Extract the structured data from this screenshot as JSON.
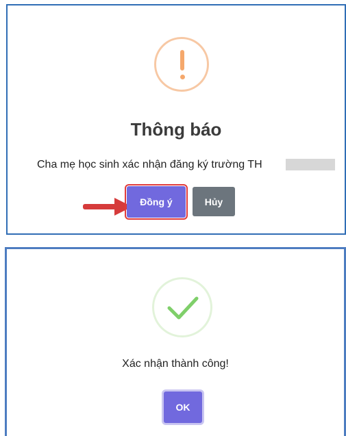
{
  "confirm_dialog": {
    "icon": "exclamation-icon",
    "title": "Thông báo",
    "message": "Cha mẹ học sinh xác nhận đăng ký trường TH",
    "agree_label": "Đồng ý",
    "cancel_label": "Hủy",
    "arrow_icon": "red-arrow-icon"
  },
  "success_dialog": {
    "icon": "checkmark-icon",
    "message": "Xác nhận thành công!",
    "ok_label": "OK"
  },
  "colors": {
    "primary": "#7169de",
    "secondary": "#6c757d",
    "warning": "#f5a86c",
    "success": "#7fcf6a",
    "highlight": "#e03a3a",
    "frame": "#2f6db5"
  }
}
